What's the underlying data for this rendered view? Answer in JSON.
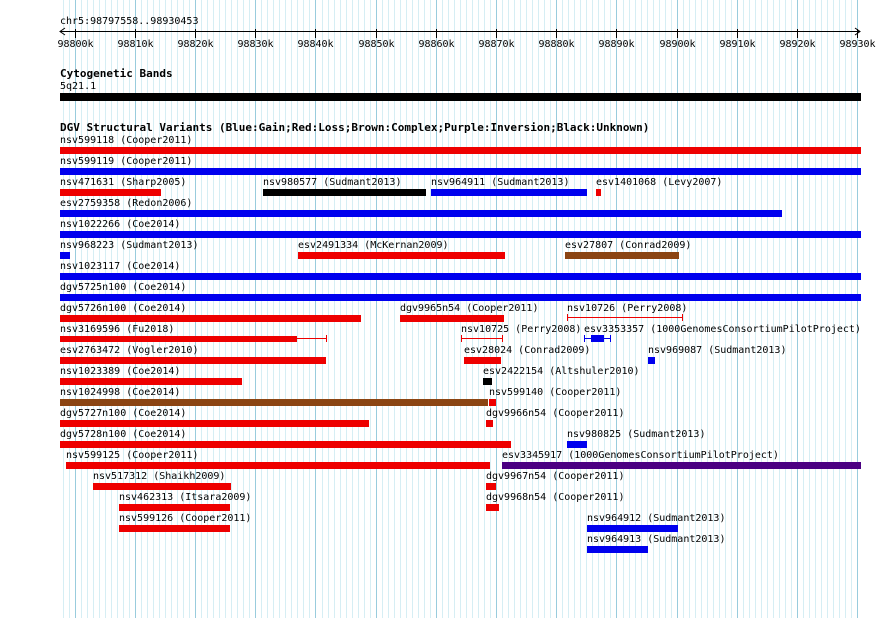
{
  "position_label": "chr5:98797558..98930453",
  "ruler": {
    "start": 98797558,
    "end": 98930453,
    "tick_labels": [
      "98800k",
      "98810k",
      "98820k",
      "98830k",
      "98840k",
      "98850k",
      "98860k",
      "98870k",
      "98880k",
      "98890k",
      "98900k",
      "98910k",
      "98920k",
      "98930k"
    ]
  },
  "tracks": {
    "cytoband": {
      "title": "Cytogenetic Bands",
      "band_label": "5q21.1",
      "color": "#000000"
    },
    "dgv": {
      "title": "DGV Structural Variants (Blue:Gain;Red:Loss;Brown:Complex;Purple:Inversion;Black:Unknown)",
      "colors": {
        "gain": "#0000ee",
        "loss": "#ee0000",
        "complex": "#8b4513",
        "inversion": "#4b0082",
        "unknown": "#000000"
      },
      "features": [
        {
          "label": "nsv599118 (Cooper2011)",
          "type": "loss"
        },
        {
          "label": "nsv599119 (Cooper2011)",
          "type": "gain"
        },
        {
          "label": "nsv471631 (Sharp2005)",
          "type": "loss"
        },
        {
          "label": "nsv980577 (Sudmant2013)",
          "type": "unknown"
        },
        {
          "label": "nsv964911 (Sudmant2013)",
          "type": "gain"
        },
        {
          "label": "esv1401068 (Levy2007)",
          "type": "loss"
        },
        {
          "label": "esv2759358 (Redon2006)",
          "type": "gain"
        },
        {
          "label": "nsv1022266 (Coe2014)",
          "type": "gain"
        },
        {
          "label": "nsv968223 (Sudmant2013)",
          "type": "gain"
        },
        {
          "label": "esv2491334 (McKernan2009)",
          "type": "loss"
        },
        {
          "label": "esv27807 (Conrad2009)",
          "type": "complex"
        },
        {
          "label": "nsv1023117 (Coe2014)",
          "type": "gain"
        },
        {
          "label": "dgv5725n100 (Coe2014)",
          "type": "gain"
        },
        {
          "label": "dgv5726n100 (Coe2014)",
          "type": "loss"
        },
        {
          "label": "dgv9965n54 (Cooper2011)",
          "type": "loss"
        },
        {
          "label": "nsv10726 (Perry2008)",
          "type": "loss"
        },
        {
          "label": "nsv3169596 (Fu2018)",
          "type": "loss"
        },
        {
          "label": "nsv10725 (Perry2008)",
          "type": "loss"
        },
        {
          "label": "esv3353357 (1000GenomesConsortiumPilotProject)",
          "type": "gain"
        },
        {
          "label": "esv2763472 (Vogler2010)",
          "type": "loss"
        },
        {
          "label": "esv28024 (Conrad2009)",
          "type": "loss"
        },
        {
          "label": "nsv969087 (Sudmant2013)",
          "type": "gain"
        },
        {
          "label": "nsv1023389 (Coe2014)",
          "type": "loss"
        },
        {
          "label": "esv2422154 (Altshuler2010)",
          "type": "unknown"
        },
        {
          "label": "nsv1024998 (Coe2014)",
          "type": "complex"
        },
        {
          "label": "nsv599140 (Cooper2011)",
          "type": "loss"
        },
        {
          "label": "dgv5727n100 (Coe2014)",
          "type": "loss"
        },
        {
          "label": "dgv9966n54 (Cooper2011)",
          "type": "loss"
        },
        {
          "label": "dgv5728n100 (Coe2014)",
          "type": "loss"
        },
        {
          "label": "nsv980825 (Sudmant2013)",
          "type": "gain"
        },
        {
          "label": "nsv599125 (Cooper2011)",
          "type": "loss"
        },
        {
          "label": "esv3345917 (1000GenomesConsortiumPilotProject)",
          "type": "inversion"
        },
        {
          "label": "nsv517312 (Shaikh2009)",
          "type": "loss"
        },
        {
          "label": "dgv9967n54 (Cooper2011)",
          "type": "loss"
        },
        {
          "label": "nsv462313 (Itsara2009)",
          "type": "loss"
        },
        {
          "label": "dgv9968n54 (Cooper2011)",
          "type": "loss"
        },
        {
          "label": "nsv599126 (Cooper2011)",
          "type": "loss"
        },
        {
          "label": "nsv964912 (Sudmant2013)",
          "type": "gain"
        },
        {
          "label": "nsv964913 (Sudmant2013)",
          "type": "gain"
        }
      ]
    }
  }
}
